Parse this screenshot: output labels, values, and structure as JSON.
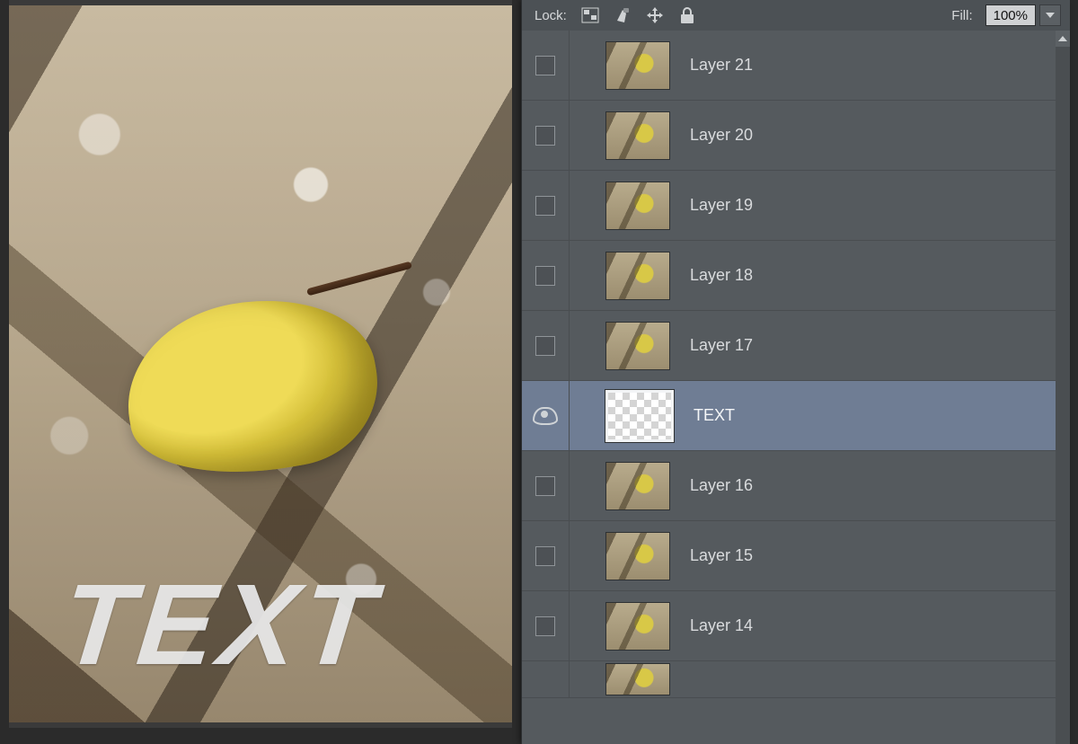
{
  "canvas": {
    "text": "TEXT"
  },
  "panel_header": {
    "lock_label": "Lock:",
    "fill_label": "Fill:",
    "fill_value": "100%"
  },
  "icons": {
    "transparency": "transparency-lock",
    "brush": "brush-lock",
    "move": "position-lock",
    "lock": "lock-all"
  },
  "layers": [
    {
      "name": "Layer 21",
      "visible": false,
      "selected": false,
      "thumb": "image"
    },
    {
      "name": "Layer 20",
      "visible": false,
      "selected": false,
      "thumb": "image"
    },
    {
      "name": "Layer 19",
      "visible": false,
      "selected": false,
      "thumb": "image"
    },
    {
      "name": "Layer 18",
      "visible": false,
      "selected": false,
      "thumb": "image"
    },
    {
      "name": "Layer 17",
      "visible": false,
      "selected": false,
      "thumb": "image"
    },
    {
      "name": "TEXT",
      "visible": true,
      "selected": true,
      "thumb": "text"
    },
    {
      "name": "Layer 16",
      "visible": false,
      "selected": false,
      "thumb": "image"
    },
    {
      "name": "Layer 15",
      "visible": false,
      "selected": false,
      "thumb": "image"
    },
    {
      "name": "Layer 14",
      "visible": false,
      "selected": false,
      "thumb": "image"
    },
    {
      "name": "",
      "visible": false,
      "selected": false,
      "thumb": "image",
      "cut": true
    }
  ]
}
